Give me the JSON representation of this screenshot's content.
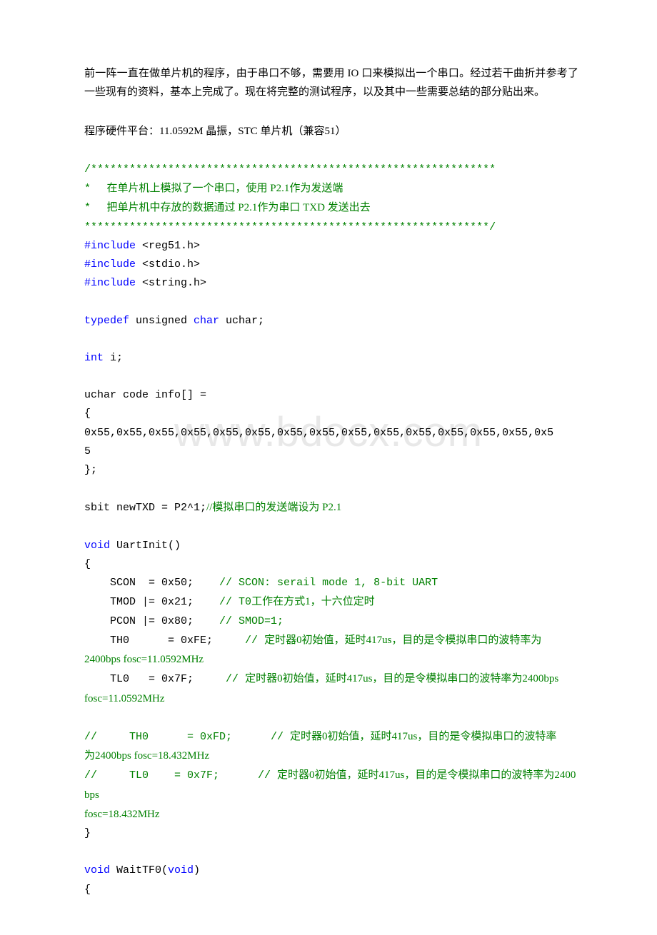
{
  "watermark": "www.bdocx.com",
  "intro": {
    "p1": "前一阵一直在做单片机的程序，由于串口不够，需要用 IO 口来模拟出一个串口。经过若干曲折并参考了一些现有的资料，基本上完成了。现在将完整的测试程序，以及其中一些需要总结的部分贴出来。",
    "p2": "程序硬件平台：11.0592M 晶振，STC 单片机（兼容51）"
  },
  "code": {
    "block_top": "/***************************************************************",
    "comment1_star": "*",
    "comment1_text": "      在单片机上模拟了一个串口，使用 P2.1作为发送端",
    "comment2_star": "*",
    "comment2_text": "      把单片机中存放的数据通过 P2.1作为串口 TXD 发送出去",
    "block_bottom": "***************************************************************/",
    "inc1_a": "#include",
    "inc1_b": " <reg51.h>",
    "inc2_a": "#include",
    "inc2_b": " <stdio.h>",
    "inc3_a": "#include",
    "inc3_b": " <string.h>",
    "typedef_a": "typedef",
    "typedef_b": " unsigned ",
    "typedef_c": "char",
    "typedef_d": " uchar;",
    "int_a": "int",
    "int_b": " i;",
    "info1": "uchar code info[] =",
    "info2": "{",
    "info3": "0x55,0x55,0x55,0x55,0x55,0x55,0x55,0x55,0x55,0x55,0x55,0x55,0x55,0x55,0x5",
    "info4": "5",
    "info5": "};",
    "sbit_code": "sbit newTXD = P2^1;",
    "sbit_comment": "//模拟串口的发送端设为 P2.1",
    "uartinit_a": "void",
    "uartinit_b": " UartInit()",
    "brace_open": "{",
    "scon_pad": "    SCON  = 0x50;    ",
    "scon_comment": "// SCON: serail mode 1, 8-bit UART",
    "tmod_pad": "    TMOD |= 0x21;    ",
    "tmod_comment_a": "// T0",
    "tmod_comment_b": "工作在方式1，十六位定时",
    "pcon_pad": "    PCON |= 0x80;    ",
    "pcon_comment": "// SMOD=1;",
    "th0_pad": "    TH0      = 0xFE;     ",
    "th0_comment_a": "// ",
    "th0_comment_b": "定时器0初始值，延时417us，目的是令模拟串口的波特率为",
    "th0_line2": "2400bps fosc=11.0592MHz",
    "tl0_pad": "    TL0   = 0x7F;     ",
    "tl0_comment_a": "// ",
    "tl0_comment_b": "定时器0初始值，延时417us，目的是令模拟串口的波特率为2400bps",
    "tl0_line2": "fosc=11.0592MHz",
    "cm_th0_pad": "//     TH0      = 0xFD;      // ",
    "cm_th0_b": "定时器0初始值，延时417us，目的是令模拟串口的波特率",
    "cm_th0_line2": "为2400bps fosc=18.432MHz",
    "cm_tl0_pad": "//     TL0    = 0x7F;      // ",
    "cm_tl0_b": "定时器0初始值，延时417us，目的是令模拟串口的波特率为2400bps",
    "cm_tl0_line2": "fosc=18.432MHz",
    "brace_close": "}",
    "waittf_a": "void",
    "waittf_b": " WaitTF0(",
    "waittf_c": "void",
    "waittf_d": ")"
  }
}
